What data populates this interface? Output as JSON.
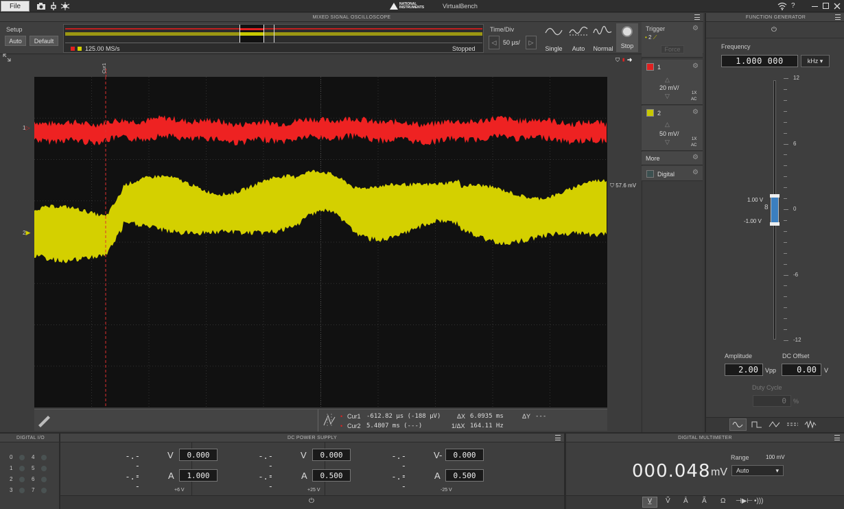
{
  "titlebar": {
    "file_menu": "File",
    "brand": "NATIONAL INSTRUMENTS",
    "app_name": "VirtualBench",
    "help_label": "?"
  },
  "osc": {
    "title": "MIXED SIGNAL OSCILLOSCOPE",
    "setup_label": "Setup",
    "auto_label": "Auto",
    "default_label": "Default",
    "sample_rate": "125.00 MS/s",
    "status": "Stopped",
    "timediv_label": "Time/Div",
    "timediv_value": "50 µs/",
    "mode_single": "Single",
    "mode_auto": "Auto",
    "mode_normal": "Normal",
    "mode_stop": "Stop",
    "cursor_tag": "Cur1",
    "ch1_marker": "1",
    "ch2_marker": "2",
    "trigger_level": "57.6 mV",
    "trace_colors": {
      "ch1": "#ee2222",
      "ch2": "#d4d000"
    }
  },
  "trigger": {
    "label": "Trigger",
    "source": "2",
    "force_label": "Force"
  },
  "channels": [
    {
      "name": "1",
      "scale": "20 mV/",
      "probe": "1X",
      "coupling": "AC",
      "color": "#e02020"
    },
    {
      "name": "2",
      "scale": "50 mV/",
      "probe": "1X",
      "coupling": "AC",
      "color": "#c8c800"
    }
  ],
  "more_label": "More",
  "digital_label": "Digital",
  "cursors": {
    "cur1_label": "Cur1",
    "cur1_value": "-612.82 µs (-188 µV)",
    "cur2_label": "Cur2",
    "cur2_value": "5.4807 ms (---)",
    "dx_label": "ΔX",
    "dx_value": "6.0935 ms",
    "inv_dx_label": "1/ΔX",
    "inv_dx_value": "164.11 Hz",
    "dy_label": "ΔY",
    "dy_value": "---"
  },
  "fgen": {
    "title": "FUNCTION GENERATOR",
    "frequency_label": "Frequency",
    "frequency_value": "1.000 000",
    "frequency_unit": "kHz",
    "scale_ticks": [
      "12",
      "6",
      "0",
      "-6",
      "-12"
    ],
    "high_label": "1.00 V",
    "low_label": "-1.00 V",
    "amplitude_label": "Amplitude",
    "amplitude_value": "2.00",
    "amplitude_unit": "Vpp",
    "offset_label": "DC Offset",
    "offset_value": "0.00",
    "offset_unit": "V",
    "duty_label": "Duty Cycle",
    "duty_value": "0",
    "duty_unit": "%"
  },
  "dio": {
    "title": "DIGITAL I/O",
    "pins": [
      "0",
      "4",
      "1",
      "5",
      "2",
      "6",
      "3",
      "7"
    ]
  },
  "psu": {
    "title": "DC POWER SUPPLY",
    "channels": [
      {
        "v_read": "-.---",
        "v_unit": "V",
        "v_set": "0.000",
        "a_read": "-.---",
        "a_unit": "A",
        "a_set": "1.000",
        "name": "+6 V"
      },
      {
        "v_read": "-.---",
        "v_unit": "V",
        "v_set": "0.000",
        "a_read": "-.---",
        "a_unit": "A",
        "a_set": "0.500",
        "name": "+25 V"
      },
      {
        "v_read": "-.---",
        "v_unit": "V-",
        "v_set": "0.000",
        "a_read": "-.---",
        "a_unit": "A",
        "a_set": "0.500",
        "name": "-25 V"
      }
    ]
  },
  "dmm": {
    "title": "DIGITAL MULTIMETER",
    "range_label": "Range",
    "range_value": "100 mV",
    "range_select": "Auto",
    "reading": "000.048",
    "reading_unit": "mV"
  }
}
